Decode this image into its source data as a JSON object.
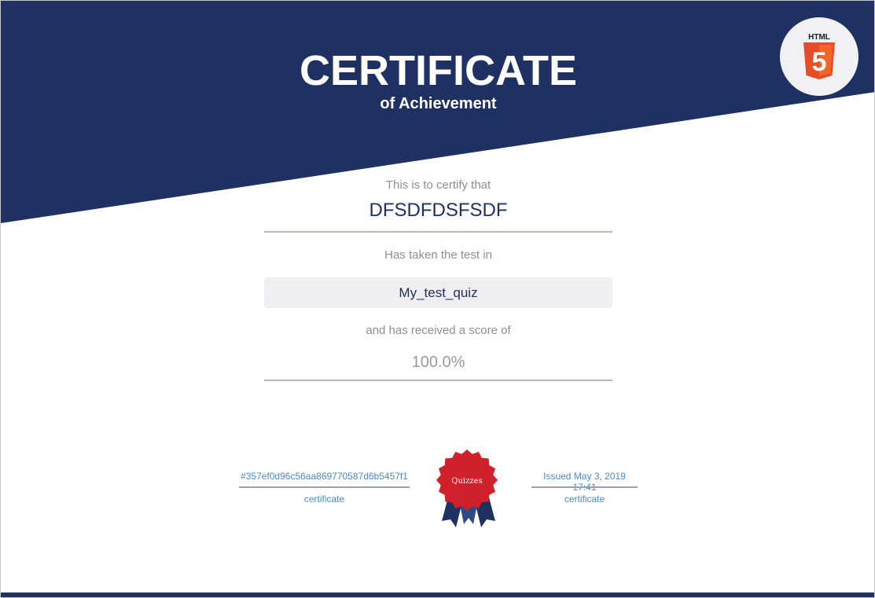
{
  "certificate": {
    "title": "CERTIFICATE",
    "subtitle": "of Achievement",
    "certify_label": "This is to certify that",
    "recipient_name": "DFSDFDSFSDF",
    "test_label": "Has taken the test in",
    "quiz_name": "My_test_quiz",
    "score_label": "and has received a score of",
    "score_value": "100.0%"
  },
  "logo": {
    "icon": "html5-icon",
    "text": "HTML",
    "glyph": "5"
  },
  "footer": {
    "certificate_id": "#357ef0d96c56aa869770587d6b5457f1",
    "certificate_id_caption": "certificate",
    "issued": "Issued May 3, 2019 17:41",
    "issued_caption": "certificate",
    "seal_text": "Quizzes"
  },
  "colors": {
    "navy": "#1f3162",
    "seal_red": "#d0202b",
    "html5_orange": "#e44d26",
    "link_blue": "#4a8ac6"
  }
}
